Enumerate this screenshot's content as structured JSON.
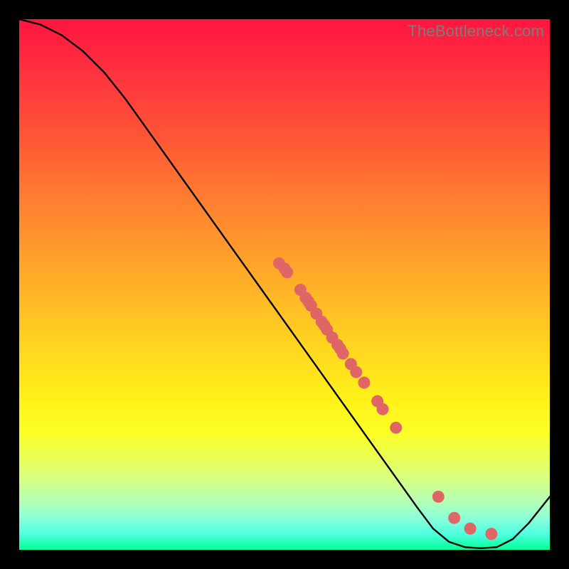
{
  "watermark": "TheBottleneck.com",
  "chart_data": {
    "type": "line",
    "title": "",
    "xlabel": "",
    "ylabel": "",
    "xlim": [
      0,
      100
    ],
    "ylim": [
      0,
      100
    ],
    "curve": [
      {
        "x": 0,
        "y": 100
      },
      {
        "x": 4,
        "y": 99
      },
      {
        "x": 8,
        "y": 97
      },
      {
        "x": 12,
        "y": 94
      },
      {
        "x": 16,
        "y": 90
      },
      {
        "x": 20,
        "y": 85
      },
      {
        "x": 25,
        "y": 78
      },
      {
        "x": 30,
        "y": 71
      },
      {
        "x": 35,
        "y": 64
      },
      {
        "x": 40,
        "y": 57
      },
      {
        "x": 45,
        "y": 50
      },
      {
        "x": 50,
        "y": 43
      },
      {
        "x": 55,
        "y": 36
      },
      {
        "x": 60,
        "y": 29
      },
      {
        "x": 65,
        "y": 22
      },
      {
        "x": 70,
        "y": 15
      },
      {
        "x": 75,
        "y": 8
      },
      {
        "x": 78,
        "y": 4
      },
      {
        "x": 81,
        "y": 1.5
      },
      {
        "x": 84,
        "y": 0.5
      },
      {
        "x": 87,
        "y": 0.3
      },
      {
        "x": 90,
        "y": 0.5
      },
      {
        "x": 93,
        "y": 2
      },
      {
        "x": 96,
        "y": 5
      },
      {
        "x": 100,
        "y": 10
      }
    ],
    "points": [
      {
        "x": 49,
        "y": 54
      },
      {
        "x": 50,
        "y": 53
      },
      {
        "x": 50.5,
        "y": 52.3
      },
      {
        "x": 53,
        "y": 49
      },
      {
        "x": 54,
        "y": 47.5
      },
      {
        "x": 54.5,
        "y": 46.8
      },
      {
        "x": 55,
        "y": 46
      },
      {
        "x": 56,
        "y": 44.5
      },
      {
        "x": 57,
        "y": 43
      },
      {
        "x": 57.5,
        "y": 42.3
      },
      {
        "x": 58,
        "y": 41.5
      },
      {
        "x": 59,
        "y": 40
      },
      {
        "x": 60,
        "y": 38.6
      },
      {
        "x": 60.5,
        "y": 37.9
      },
      {
        "x": 61,
        "y": 37
      },
      {
        "x": 62.5,
        "y": 35
      },
      {
        "x": 63.5,
        "y": 33.5
      },
      {
        "x": 65,
        "y": 31.5
      },
      {
        "x": 67.5,
        "y": 28
      },
      {
        "x": 68.5,
        "y": 26.5
      },
      {
        "x": 71,
        "y": 23
      },
      {
        "x": 79,
        "y": 10
      },
      {
        "x": 82,
        "y": 6
      },
      {
        "x": 85,
        "y": 4
      },
      {
        "x": 89,
        "y": 3
      }
    ],
    "point_color": "#e06666",
    "curve_color": "#000000"
  }
}
